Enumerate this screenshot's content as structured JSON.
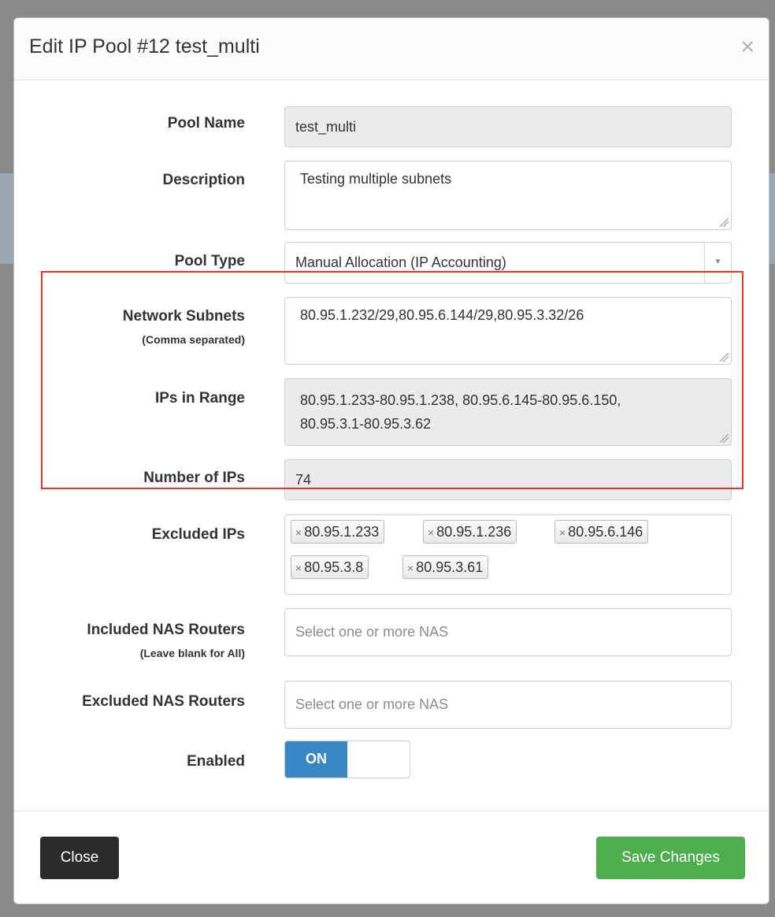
{
  "modal": {
    "title": "Edit IP Pool #12 test_multi",
    "close_glyph": "×"
  },
  "form": {
    "pool_name": {
      "label": "Pool Name",
      "value": "test_multi"
    },
    "description": {
      "label": "Description",
      "value": "Testing multiple subnets"
    },
    "pool_type": {
      "label": "Pool Type",
      "value": "Manual Allocation (IP Accounting)"
    },
    "network_subnets": {
      "label": "Network Subnets",
      "sublabel": "(Comma separated)",
      "value": "80.95.1.232/29,80.95.6.144/29,80.95.3.32/26"
    },
    "ips_in_range": {
      "label": "IPs in Range",
      "line1": "80.95.1.233-80.95.1.238, 80.95.6.145-80.95.6.150,",
      "line2": "80.95.3.1-80.95.3.62"
    },
    "number_of_ips": {
      "label": "Number of IPs",
      "value": "74"
    },
    "excluded_ips": {
      "label": "Excluded IPs",
      "tags": [
        "80.95.1.233",
        "80.95.1.236",
        "80.95.6.146",
        "80.95.3.8",
        "80.95.3.61"
      ],
      "tag_remove_glyph": "×"
    },
    "included_nas": {
      "label": "Included NAS Routers",
      "sublabel": "(Leave blank for All)",
      "placeholder": "Select one or more NAS"
    },
    "excluded_nas": {
      "label": "Excluded NAS Routers",
      "placeholder": "Select one or more NAS"
    },
    "enabled": {
      "label": "Enabled",
      "state": "ON"
    }
  },
  "footer": {
    "close_label": "Close",
    "save_label": "Save Changes"
  },
  "colors": {
    "highlight": "#e8331f",
    "toggle_on": "#3a87c8",
    "save_button": "#4cae4c",
    "close_button": "#2b2b2b"
  }
}
